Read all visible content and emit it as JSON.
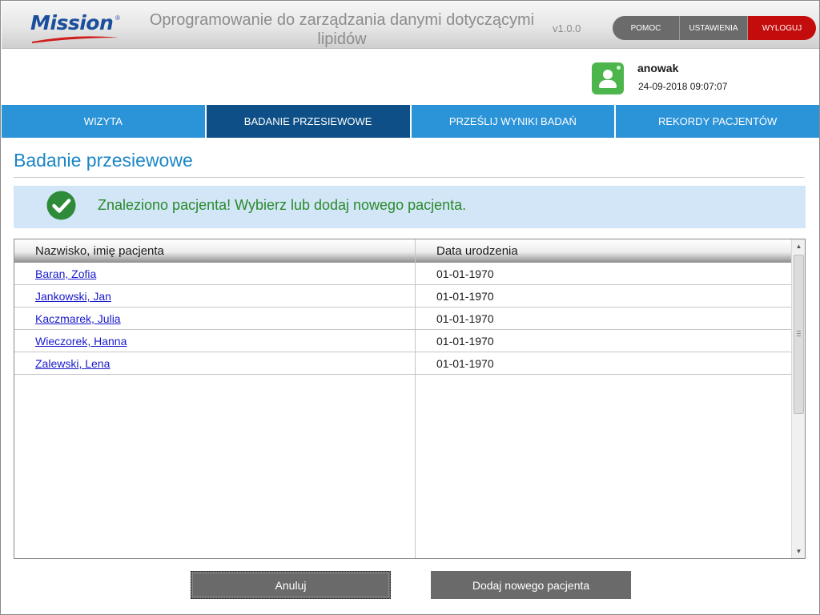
{
  "header": {
    "logo_text": "Mission",
    "logo_reg": "®",
    "title": "Oprogramowanie do zarządzania danymi dotyczącymi lipidów",
    "version": "v1.0.0",
    "buttons": {
      "help": "POMOC",
      "settings": "USTAWIENIA",
      "logout": "WYLOGUJ"
    },
    "colors": {
      "logo": "#1b4f9c",
      "logout": "#c40c0c",
      "button": "#6b6b6b"
    }
  },
  "user": {
    "icon": "user-avatar-icon",
    "name": "anowak",
    "datetime": "24-09-2018 09:07:07"
  },
  "nav": {
    "tabs": [
      {
        "label": "WIZYTA",
        "active": false
      },
      {
        "label": "BADANIE PRZESIEWOWE",
        "active": true
      },
      {
        "label": "PRZEŚLIJ WYNIKI BADAŃ",
        "active": false
      },
      {
        "label": "REKORDY PACJENTÓW",
        "active": false
      }
    ],
    "colors": {
      "tab": "#2b93d8",
      "active": "#0d4f86"
    }
  },
  "page": {
    "title": "Badanie przesiewowe"
  },
  "alert": {
    "icon": "check-circle-icon",
    "message": "Znaleziono pacjenta! Wybierz lub dodaj nowego pacjenta.",
    "colors": {
      "background": "#d2e6f8",
      "text": "#2a8a2a"
    }
  },
  "table": {
    "columns": [
      "Nazwisko, imię pacjenta",
      "Data urodzenia"
    ],
    "rows": [
      {
        "name": "Baran, Zofia",
        "birth_date": "01-01-1970"
      },
      {
        "name": "Jankowski, Jan",
        "birth_date": "01-01-1970"
      },
      {
        "name": "Kaczmarek, Julia",
        "birth_date": "01-01-1970"
      },
      {
        "name": "Wieczorek, Hanna",
        "birth_date": "01-01-1970"
      },
      {
        "name": "Zalewski, Lena",
        "birth_date": "01-01-1970"
      }
    ]
  },
  "footer": {
    "cancel_label": "Anuluj",
    "add_label": "Dodaj nowego pacjenta"
  }
}
